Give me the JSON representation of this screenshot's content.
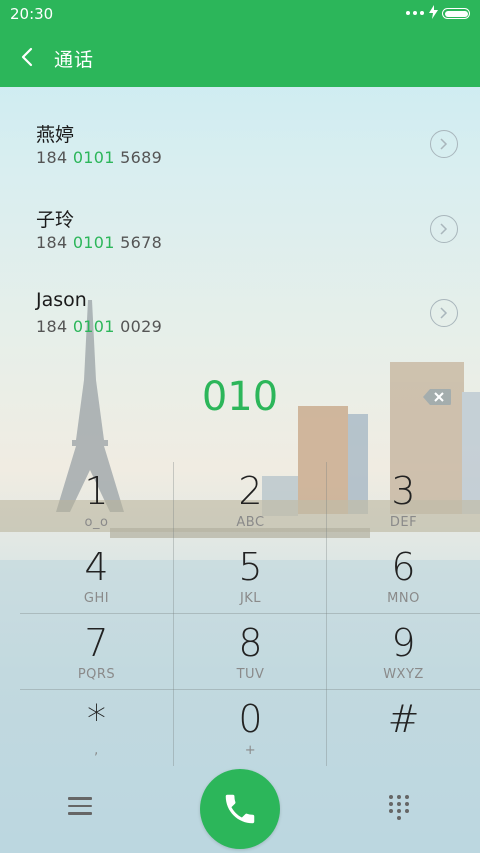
{
  "status_bar": {
    "time": "20:30"
  },
  "header": {
    "title": "通话"
  },
  "contacts": [
    {
      "name": "燕婷",
      "number_prefix": "184 ",
      "number_match": "0101",
      "number_suffix": " 5689"
    },
    {
      "name": "子玲",
      "number_prefix": "184 ",
      "number_match": "0101",
      "number_suffix": " 5678"
    },
    {
      "name": "Jason",
      "number_prefix": "184 ",
      "number_match": "0101",
      "number_suffix": " 0029"
    }
  ],
  "dialer": {
    "input": "010"
  },
  "keypad": [
    {
      "digit": "1",
      "letters": "o_o"
    },
    {
      "digit": "2",
      "letters": "ABC"
    },
    {
      "digit": "3",
      "letters": "DEF"
    },
    {
      "digit": "4",
      "letters": "GHI"
    },
    {
      "digit": "5",
      "letters": "JKL"
    },
    {
      "digit": "6",
      "letters": "MNO"
    },
    {
      "digit": "7",
      "letters": "PQRS"
    },
    {
      "digit": "8",
      "letters": "TUV"
    },
    {
      "digit": "9",
      "letters": "WXYZ"
    },
    {
      "digit": "*",
      "letters": ","
    },
    {
      "digit": "0",
      "letters": "+"
    },
    {
      "digit": "#",
      "letters": ""
    }
  ],
  "colors": {
    "accent": "#2cb65a",
    "text": "#222222",
    "secondary": "#8a8a8a"
  },
  "icons": {
    "back": "chevron-left-icon",
    "contact_arrow": "chevron-right-circle-icon",
    "backspace": "backspace-icon",
    "menu": "menu-icon",
    "call": "phone-icon",
    "dialpad": "dialpad-icon"
  }
}
